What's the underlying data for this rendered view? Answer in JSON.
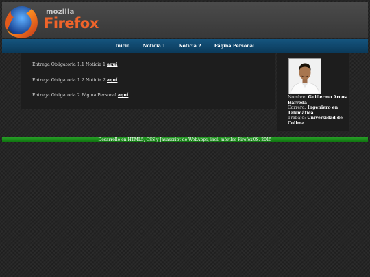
{
  "header": {
    "brand_small": "mozilla",
    "brand_big": "Firefox",
    "logo_icon": "firefox-logo-icon"
  },
  "nav": {
    "items": [
      "Inicio",
      "Noticia 1",
      "Noticia 2",
      "Página Personal"
    ]
  },
  "entries": [
    {
      "text": "Entrega Obligatoria 1.1 Noticia 1 ",
      "link": "aquí"
    },
    {
      "text": "Entrega Obligatoria 1.2 Noticia 2 ",
      "link": "aquí"
    },
    {
      "text": "Entrega Obligatoria 2 Página Personal ",
      "link": "aquí"
    }
  ],
  "profile": {
    "name_label": "Nombre: ",
    "name": "Guillermo Arcos Barreda",
    "career_label": "Carrera: ",
    "career": "Ingeniero en Telemática",
    "work_label": "Trabajo: ",
    "work": "Universidad de Colima"
  },
  "footer": {
    "text": "Desarrollo en HTML5, CSS y Javascript de WebApps, incl. móviles FirefoxOS. 2015"
  }
}
